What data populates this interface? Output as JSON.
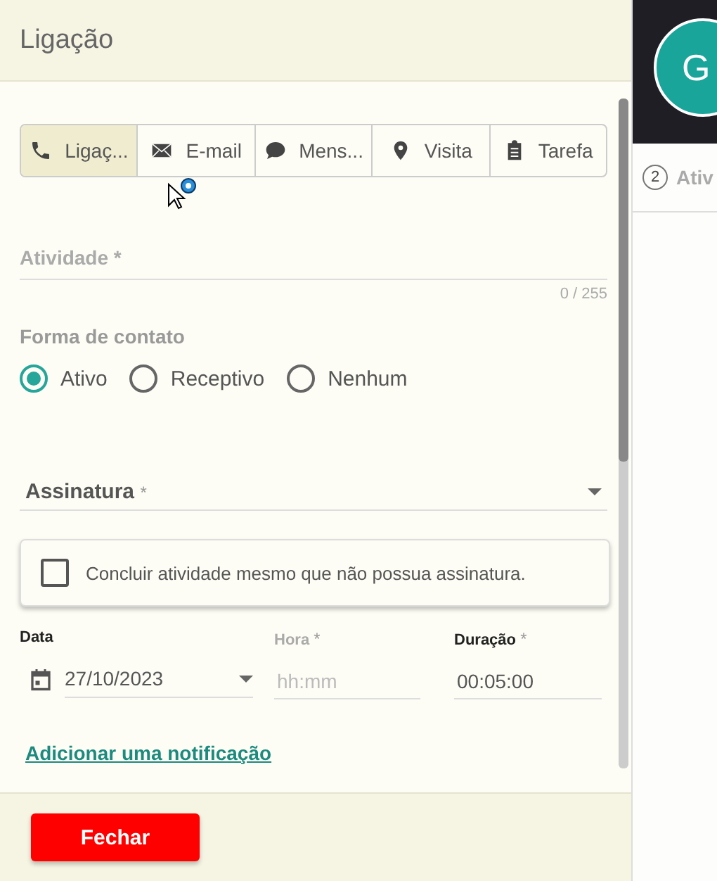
{
  "dialog": {
    "title": "Ligação",
    "tabs": [
      {
        "label": "Ligaç...",
        "kind": "phone",
        "selected": true
      },
      {
        "label": "E-mail",
        "kind": "mail",
        "selected": false
      },
      {
        "label": "Mens...",
        "kind": "chat",
        "selected": false
      },
      {
        "label": "Visita",
        "kind": "pin",
        "selected": false
      },
      {
        "label": "Tarefa",
        "kind": "clipboard",
        "selected": false
      }
    ],
    "activity": {
      "label": "Atividade",
      "required": "*",
      "counter": "0 / 255"
    },
    "contact": {
      "label": "Forma de contato",
      "options": [
        {
          "label": "Ativo",
          "selected": true
        },
        {
          "label": "Receptivo",
          "selected": false
        },
        {
          "label": "Nenhum",
          "selected": false
        }
      ]
    },
    "signature": {
      "label": "Assinatura",
      "required": "*"
    },
    "complete": {
      "label": "Concluir atividade mesmo que não possua assinatura.",
      "checked": false
    },
    "date": {
      "label": "Data",
      "value": "27/10/2023"
    },
    "time": {
      "label": "Hora",
      "required": "*",
      "placeholder": "hh:mm"
    },
    "duration": {
      "label": "Duração",
      "required": "*",
      "value": "00:05:00"
    },
    "link": "Adicionar uma notificação",
    "close_button": "Fechar"
  },
  "side_panel": {
    "avatar": "G",
    "step": "2",
    "tab": "Ativ"
  }
}
